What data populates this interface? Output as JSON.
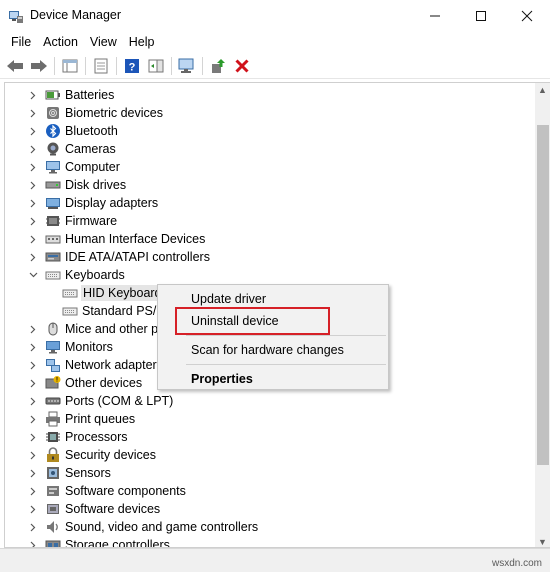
{
  "window": {
    "title": "Device Manager",
    "minimize": "—",
    "maximize": "☐",
    "close": "✕"
  },
  "menu": [
    "File",
    "Action",
    "View",
    "Help"
  ],
  "tree": [
    {
      "label": "Batteries",
      "icon": "battery-icon",
      "expand": "collapsed"
    },
    {
      "label": "Biometric devices",
      "icon": "biometric-icon",
      "expand": "collapsed"
    },
    {
      "label": "Bluetooth",
      "icon": "bluetooth-icon",
      "expand": "collapsed"
    },
    {
      "label": "Cameras",
      "icon": "camera-icon",
      "expand": "collapsed"
    },
    {
      "label": "Computer",
      "icon": "computer-icon",
      "expand": "collapsed"
    },
    {
      "label": "Disk drives",
      "icon": "disk-drive-icon",
      "expand": "collapsed"
    },
    {
      "label": "Display adapters",
      "icon": "display-adapter-icon",
      "expand": "collapsed"
    },
    {
      "label": "Firmware",
      "icon": "firmware-icon",
      "expand": "collapsed"
    },
    {
      "label": "Human Interface Devices",
      "icon": "hid-icon",
      "expand": "collapsed"
    },
    {
      "label": "IDE ATA/ATAPI controllers",
      "icon": "ide-controller-icon",
      "expand": "collapsed"
    },
    {
      "label": "Keyboards",
      "icon": "keyboard-icon",
      "expand": "expanded"
    },
    {
      "label": "HID Keyboard",
      "icon": "keyboard-icon",
      "expand": "child",
      "selected": true
    },
    {
      "label": "Standard PS/2",
      "icon": "keyboard-icon",
      "expand": "child"
    },
    {
      "label": "Mice and other p",
      "icon": "mouse-icon",
      "expand": "collapsed"
    },
    {
      "label": "Monitors",
      "icon": "monitor-icon",
      "expand": "collapsed"
    },
    {
      "label": "Network adapters",
      "icon": "network-adapter-icon",
      "expand": "collapsed"
    },
    {
      "label": "Other devices",
      "icon": "other-devices-icon",
      "expand": "collapsed"
    },
    {
      "label": "Ports (COM & LPT)",
      "icon": "port-icon",
      "expand": "collapsed"
    },
    {
      "label": "Print queues",
      "icon": "printer-icon",
      "expand": "collapsed"
    },
    {
      "label": "Processors",
      "icon": "processor-icon",
      "expand": "collapsed"
    },
    {
      "label": "Security devices",
      "icon": "security-device-icon",
      "expand": "collapsed"
    },
    {
      "label": "Sensors",
      "icon": "sensor-icon",
      "expand": "collapsed"
    },
    {
      "label": "Software components",
      "icon": "software-component-icon",
      "expand": "collapsed"
    },
    {
      "label": "Software devices",
      "icon": "software-device-icon",
      "expand": "collapsed"
    },
    {
      "label": "Sound, video and game controllers",
      "icon": "sound-icon",
      "expand": "collapsed"
    },
    {
      "label": "Storage controllers",
      "icon": "storage-controller-icon",
      "expand": "collapsed"
    }
  ],
  "context_menu": {
    "update_driver": "Update driver",
    "uninstall_device": "Uninstall device",
    "scan_hardware": "Scan for hardware changes",
    "properties": "Properties"
  },
  "watermark": "wsxdn.com",
  "colors": {
    "highlight_border": "#d62027",
    "uninstall_red": "#d0121b",
    "help_blue": "#1c55b8"
  }
}
